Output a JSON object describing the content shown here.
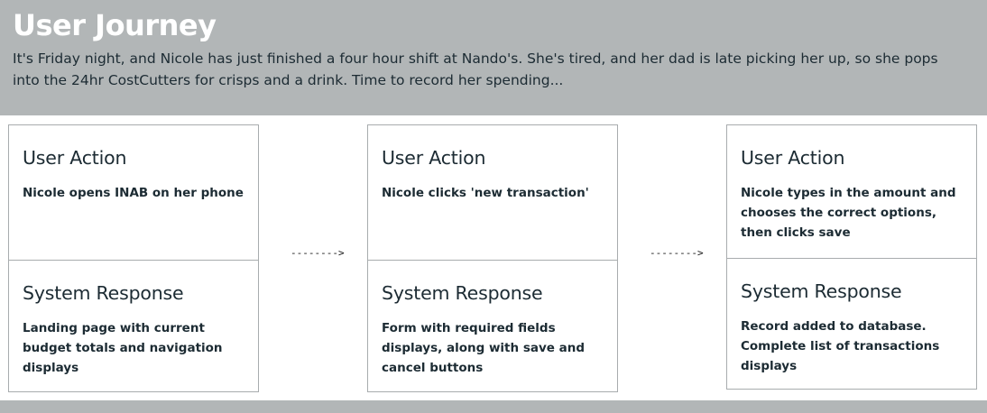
{
  "header": {
    "title": "User Journey",
    "intro": "It's Friday night, and Nicole has just finished a four hour shift at Nando's.  She's tired, and her dad is late picking her up, so she pops into the 24hr CostCutters for crisps and a drink.  Time to record her spending..."
  },
  "steps": [
    {
      "action_heading": "User Action",
      "action_text": "Nicole opens INAB on her phone",
      "response_heading": "System Response",
      "response_text": "Landing page with current budget totals and navigation displays"
    },
    {
      "action_heading": "User Action",
      "action_text": "Nicole clicks 'new transaction'",
      "response_heading": "System Response",
      "response_text": "Form with required fields displays, along with save and cancel buttons"
    },
    {
      "action_heading": "User Action",
      "action_text": "Nicole types in the amount and chooses the correct options, then clicks save",
      "response_heading": "System Response",
      "response_text": "Record added to database. Complete list of transactions displays"
    }
  ],
  "arrows": [
    "-------->",
    "-------->"
  ]
}
